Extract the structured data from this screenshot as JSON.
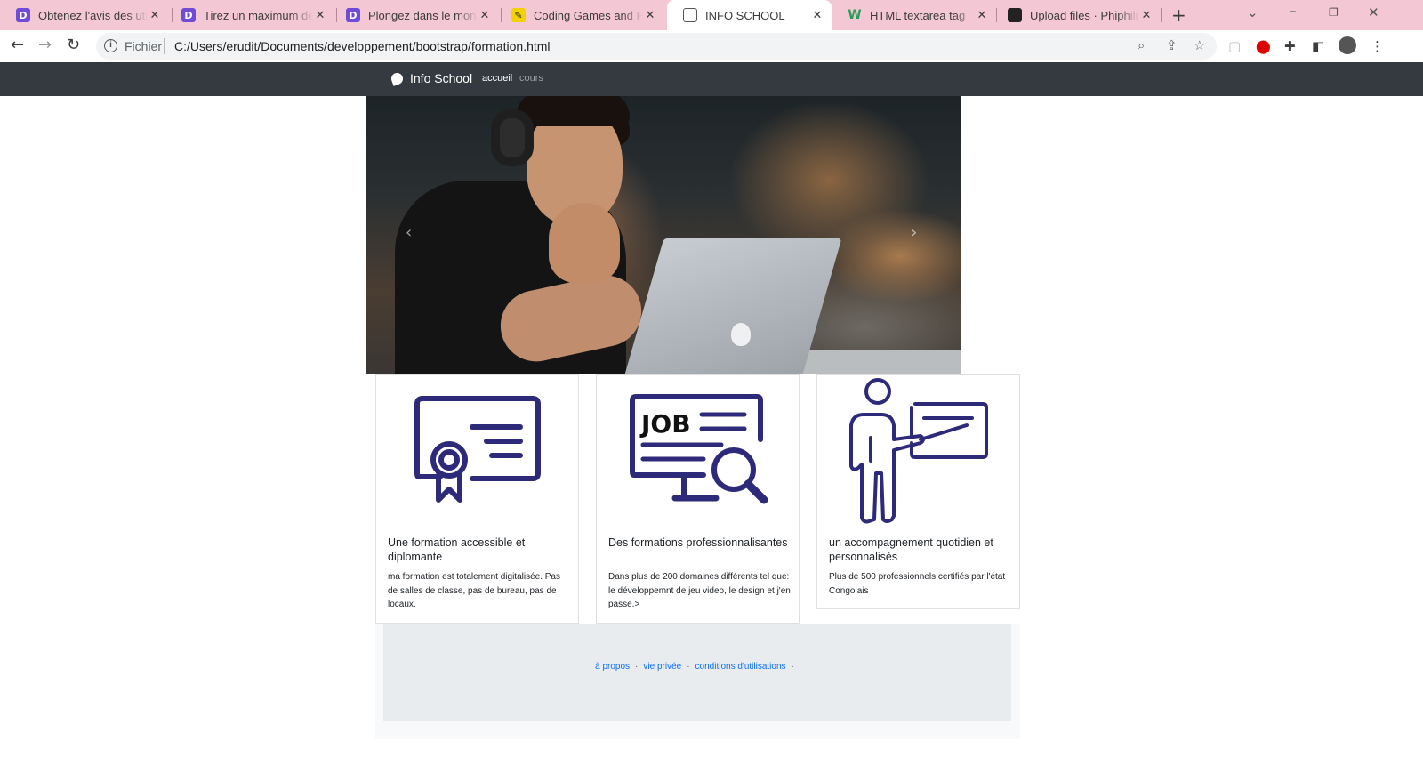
{
  "browser": {
    "tabs": [
      {
        "title": "Obtenez l'avis des utilisateurs",
        "favicon": "d-logo",
        "active": false
      },
      {
        "title": "Tirez un maximum de contenu",
        "favicon": "d-logo",
        "active": false
      },
      {
        "title": "Plongez dans le monde",
        "favicon": "d-logo",
        "active": false
      },
      {
        "title": "Coding Games and Programming",
        "favicon": "codingame-logo",
        "active": false
      },
      {
        "title": "INFO SCHOOL",
        "favicon": "globe-icon",
        "active": true
      },
      {
        "title": "HTML textarea tag",
        "favicon": "w3schools-logo",
        "active": false
      },
      {
        "title": "Upload files · Phiphilio/",
        "favicon": "github-logo",
        "active": false
      }
    ],
    "address": {
      "scheme_label": "Fichier",
      "url": "C:/Users/erudit/Documents/developpement/bootstrap/formation.html"
    },
    "colors": {
      "tabstrip": "#f4c7d5",
      "toolbar": "#ffffff"
    }
  },
  "site": {
    "brand": "Info School",
    "nav": [
      {
        "label": "accueil",
        "active": true
      },
      {
        "label": "cours",
        "active": false
      }
    ],
    "hero": {
      "prev_icon": "chevron-left-icon",
      "next_icon": "chevron-right-icon"
    },
    "cards": [
      {
        "icon": "certificate-icon",
        "title": "Une formation accessible et diplomante",
        "text": "ma formation est totalement digitalisée. Pas de salles de classe, pas de bureau, pas de locaux."
      },
      {
        "icon": "job-search-monitor-icon",
        "icon_text": "JOB",
        "title": "Des formations professionnalisantes",
        "text": "Dans plus de 200 domaines différents tel que: le développemnt de jeu video, le design et j'en passe.>"
      },
      {
        "icon": "teacher-board-icon",
        "title": "un accompagnement quotidien et personnalisés",
        "text": "Plus de 500 professionnels certifiés par l'état Congolais"
      }
    ],
    "footer": {
      "links": [
        "à propos",
        "vie privée",
        "conditions d'utilisations"
      ]
    },
    "colors": {
      "navbar": "#343a40",
      "icon_stroke": "#2e2a7a",
      "link": "#0d6efd",
      "footer_bg": "#e9ecef"
    }
  }
}
